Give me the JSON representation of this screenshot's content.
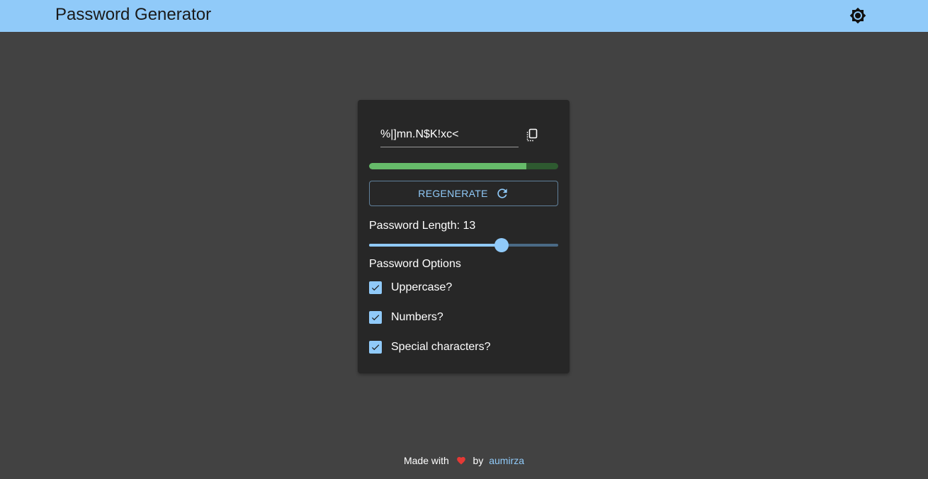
{
  "app": {
    "title": "Password Generator",
    "theme_toggle_icon": "brightness-icon",
    "bar_color": "#90caf9"
  },
  "generator": {
    "password": "%|]mn.N$K!xc<",
    "copy_icon": "copy-icon",
    "strength": {
      "fraction": 0.83,
      "fill_color": "#66bb6a",
      "track_color": "#2e5a30"
    },
    "regenerate_label": "REGENERATE",
    "regenerate_icon": "refresh-icon",
    "length_label": "Password Length: 13",
    "length": {
      "value": 13,
      "min": 6,
      "max": 16
    },
    "options_label": "Password Options",
    "options": [
      {
        "label": "Uppercase?",
        "checked": true
      },
      {
        "label": "Numbers?",
        "checked": true
      },
      {
        "label": "Special characters?",
        "checked": true
      }
    ]
  },
  "footer": {
    "made_with": "Made with",
    "heart_icon": "heart-icon",
    "by": "by",
    "author": "aumirza"
  }
}
